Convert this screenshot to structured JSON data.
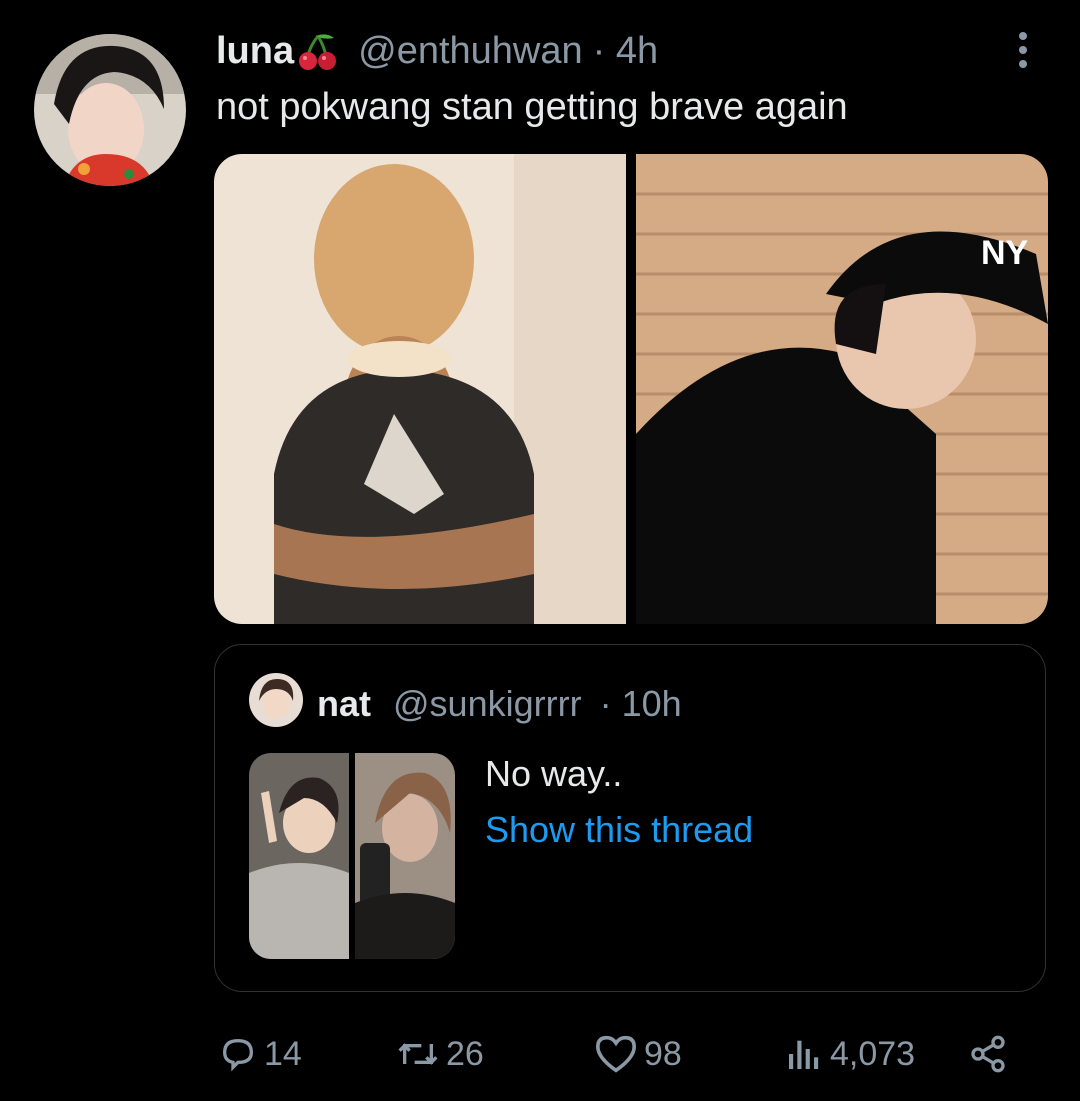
{
  "tweet": {
    "author_name": "luna",
    "author_emoji": "cherries-emoji",
    "handle": "@enthuhwan",
    "time": "· 4h",
    "text": "not pokwang stan getting brave again",
    "media": [
      "photo-girl-crossed-arms",
      "photo-boy-ny-cap-brick-wall"
    ]
  },
  "quoted": {
    "author_name": "nat",
    "handle": "@sunkigrrrr",
    "time": "· 10h",
    "text": "No way..",
    "link": "Show this thread",
    "media": [
      "photo-peace-sign-selfie",
      "photo-mirror-selfie"
    ]
  },
  "actions": {
    "replies": "14",
    "retweets": "26",
    "likes": "98",
    "views": "4,073"
  },
  "icons": {
    "more": "more-vertical-icon",
    "reply": "reply-icon",
    "retweet": "retweet-icon",
    "like": "heart-icon",
    "views": "views-icon",
    "share": "share-icon"
  },
  "colors": {
    "background": "#000000",
    "text": "#e7e9ea",
    "secondary": "#8b98a5",
    "link": "#1d9bf0",
    "border": "#2f3336"
  }
}
